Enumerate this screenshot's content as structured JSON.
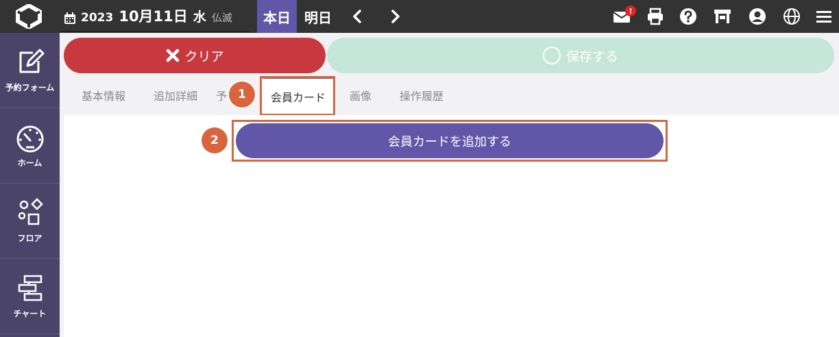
{
  "header": {
    "date": {
      "year": "2023",
      "month_day": "10月11日",
      "weekday": "水",
      "rokuyo": "仏滅"
    },
    "today_label": "本日",
    "tomorrow_label": "明日",
    "mail_badge": "!",
    "accent_color": "#6156a8"
  },
  "sidebar": {
    "items": [
      {
        "label": "予約フォーム",
        "icon": "edit-icon"
      },
      {
        "label": "ホーム",
        "icon": "dashboard-gauge-icon"
      },
      {
        "label": "フロア",
        "icon": "floor-shapes-icon"
      },
      {
        "label": "チャート",
        "icon": "chart-blocks-icon"
      }
    ]
  },
  "actions": {
    "clear_label": "クリア",
    "save_label": "保存する"
  },
  "tabs": [
    {
      "label": "基本情報"
    },
    {
      "label": "追加詳細"
    },
    {
      "label": "予"
    },
    {
      "label": "会員カード",
      "active": true
    },
    {
      "label": "画像"
    },
    {
      "label": "操作履歴"
    }
  ],
  "steps": [
    "1",
    "2"
  ],
  "content": {
    "add_card_label": "会員カードを追加する"
  }
}
